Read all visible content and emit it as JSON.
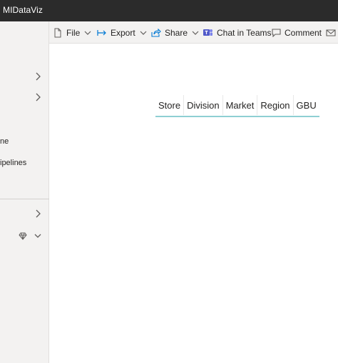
{
  "app": {
    "title": "MIDataViz"
  },
  "sidebar": {
    "items": [
      {
        "label": "ne"
      },
      {
        "label": "ipelines"
      }
    ]
  },
  "toolbar": {
    "file_label": "File",
    "export_label": "Export",
    "share_label": "Share",
    "teams_label": "Chat in Teams",
    "comment_label": "Comment"
  },
  "slicer": {
    "tiles": [
      "Store",
      "Division",
      "Market",
      "Region",
      "GBU"
    ]
  },
  "colors": {
    "titlebar": "#2b2b2b",
    "panel": "#f3f2f1",
    "accent": "#0078d4",
    "teams": "#5059c9",
    "slicer_underline": "#8fcfd3"
  }
}
